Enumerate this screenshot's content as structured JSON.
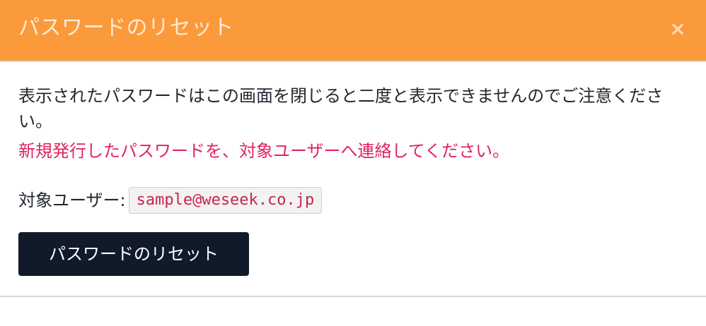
{
  "modal": {
    "title": "パスワードのリセット",
    "close_label": "×"
  },
  "body": {
    "notice": "表示されたパスワードはこの画面を閉じると二度と表示できませんのでご注意ください。",
    "warning": "新規発行したパスワードを、対象ユーザーへ連絡してください。",
    "target_label": "対象ユーザー:",
    "target_email": "sample@weseek.co.jp"
  },
  "actions": {
    "reset_label": "パスワードのリセット"
  },
  "colors": {
    "header": "#fb9a3a",
    "warning": "#e0245e",
    "button": "#101a29"
  }
}
